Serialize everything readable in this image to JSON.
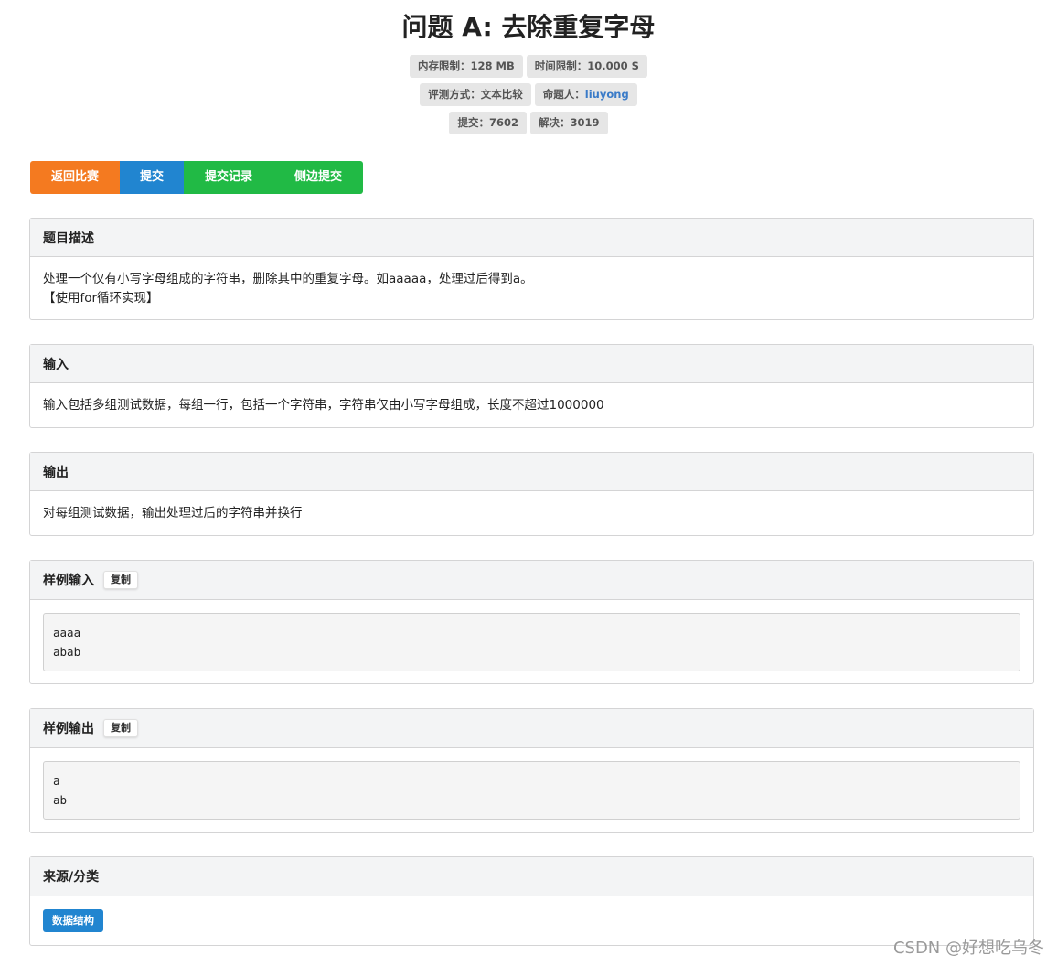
{
  "problem": {
    "title": "问题 A: 去除重复字母",
    "meta_row1": [
      {
        "label": "内存限制：",
        "value": "128 MB"
      },
      {
        "label": "时间限制：",
        "value": "10.000 S"
      }
    ],
    "meta_row2": [
      {
        "label": "评测方式：",
        "value": "文本比较"
      },
      {
        "label": "命题人：",
        "value": "liuyong"
      }
    ],
    "meta_row3": [
      {
        "label": "提交：",
        "value": "7602"
      },
      {
        "label": "解决：",
        "value": "3019"
      }
    ]
  },
  "actions": {
    "back": "返回比赛",
    "submit": "提交",
    "records": "提交记录",
    "side_submit": "侧边提交"
  },
  "sections": {
    "description": {
      "title": "题目描述",
      "line1": "处理一个仅有小写字母组成的字符串，删除其中的重复字母。如aaaaa，处理过后得到a。",
      "line2": "【使用for循环实现】"
    },
    "input": {
      "title": "输入",
      "text": "输入包括多组测试数据，每组一行，包括一个字符串，字符串仅由小写字母组成，长度不超过1000000"
    },
    "output": {
      "title": "输出",
      "text": "对每组测试数据，输出处理过后的字符串并换行"
    },
    "sample_input": {
      "title": "样例输入",
      "copy": "复制",
      "lines": [
        "aaaa",
        "abab"
      ]
    },
    "sample_output": {
      "title": "样例输出",
      "copy": "复制",
      "lines": [
        "a",
        "ab"
      ]
    },
    "source": {
      "title": "来源/分类",
      "tag": "数据结构"
    }
  },
  "watermark": "CSDN @好想吃乌冬",
  "colors": {
    "orange": "#f47a20",
    "blue": "#2185d0",
    "green": "#21ba45",
    "link": "#3a7bc8"
  }
}
